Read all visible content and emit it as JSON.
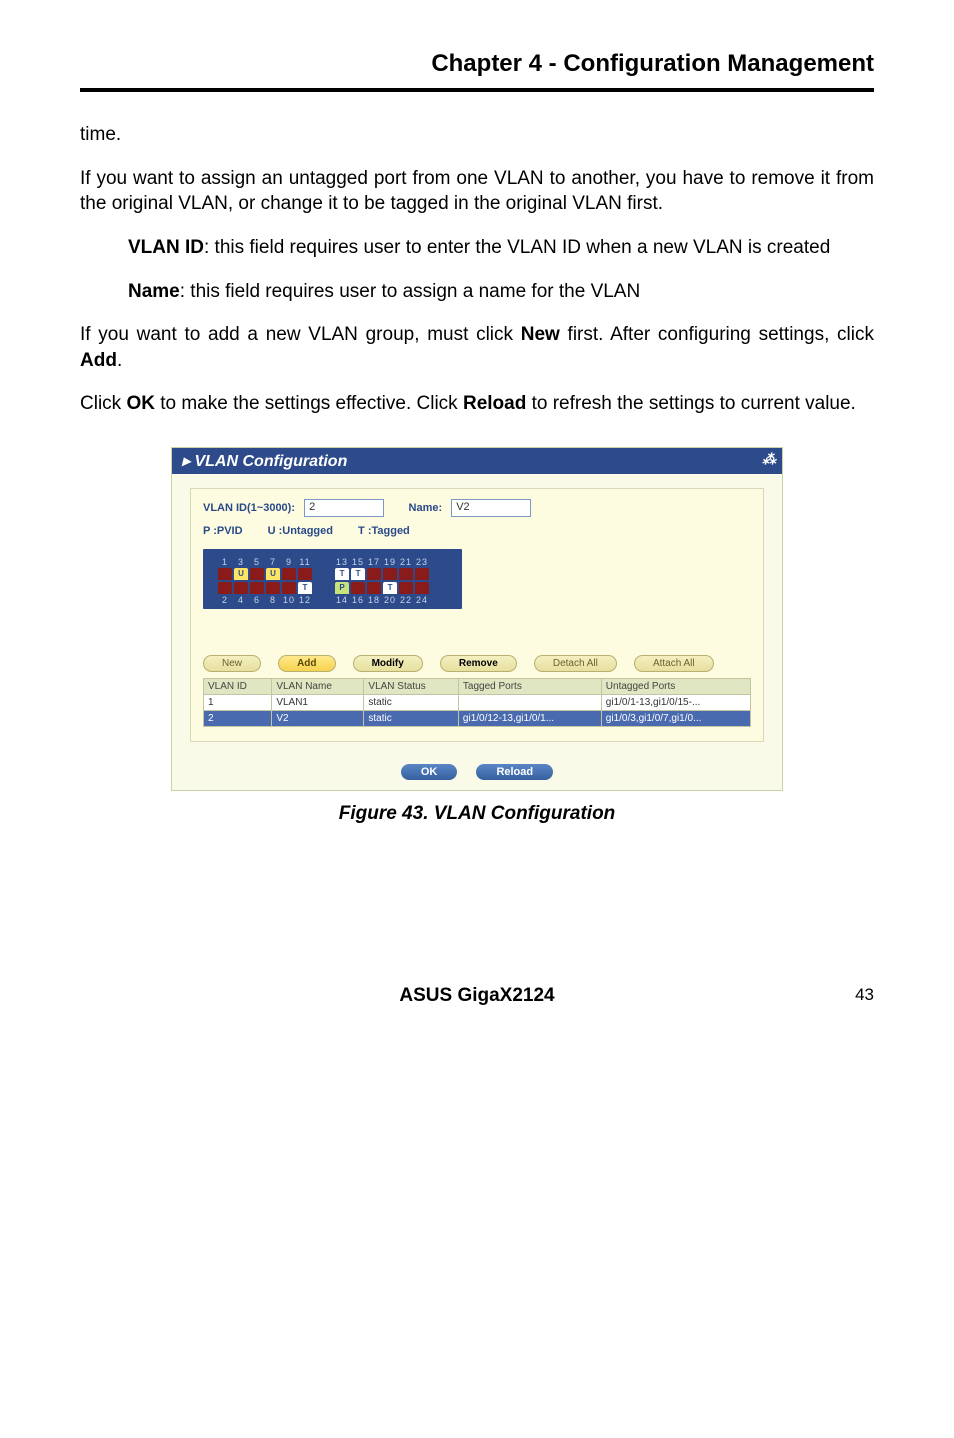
{
  "header": {
    "chapter_title": "Chapter 4 - Configuration Management"
  },
  "body": {
    "p1": "time.",
    "p2": "If you want to assign an untagged port from one VLAN to another, you have to remove it from the original VLAN, or change it to be tagged in the original VLAN first.",
    "vlanid_label": "VLAN ID",
    "vlanid_desc": ": this field requires user to enter the VLAN ID when a new VLAN is created",
    "name_label": "Name",
    "name_desc": ": this field requires user to assign a name for the VLAN",
    "p3a": "If you want to add a new VLAN group, must click ",
    "p3_new": "New",
    "p3b": " first. After configuring settings, click ",
    "p3_add": "Add",
    "p3c": ".",
    "p4a": "Click ",
    "p4_ok": "OK",
    "p4b": " to make the settings effective. Click ",
    "p4_reload": "Reload",
    "p4c": " to refresh the settings to current value."
  },
  "screenshot": {
    "window_title": "VLAN Configuration",
    "vlanid_lbl": "VLAN ID(1~3000):",
    "vlanid_val": "2",
    "name_lbl": "Name:",
    "name_val": "V2",
    "legend_p": "P :PVID",
    "legend_u": "U :Untagged",
    "legend_t": "T :Tagged",
    "top_nums_a": [
      "1",
      "3",
      "5",
      "7",
      "9",
      "11"
    ],
    "bot_nums_a": [
      "2",
      "4",
      "6",
      "8",
      "10",
      "12"
    ],
    "top_nums_b": [
      "13",
      "15",
      "17",
      "19",
      "21",
      "23"
    ],
    "bot_nums_b": [
      "14",
      "16",
      "18",
      "20",
      "22",
      "24"
    ],
    "buttons": {
      "new": "New",
      "add": "Add",
      "modify": "Modify",
      "remove": "Remove",
      "detach_all": "Detach All",
      "attach_all": "Attach All"
    },
    "table": {
      "headers": [
        "VLAN ID",
        "VLAN Name",
        "VLAN Status",
        "Tagged Ports",
        "Untagged Ports"
      ],
      "rows": [
        {
          "id": "1",
          "name": "VLAN1",
          "status": "static",
          "tagged": "",
          "untagged": "gi1/0/1-13,gi1/0/15-..."
        },
        {
          "id": "2",
          "name": "V2",
          "status": "static",
          "tagged": "gi1/0/12-13,gi1/0/1...",
          "untagged": "gi1/0/3,gi1/0/7,gi1/0..."
        }
      ]
    },
    "ok_btn": "OK",
    "reload_btn": "Reload"
  },
  "figure_caption": "Figure 43. VLAN Configuration",
  "footer": {
    "product": "ASUS GigaX2124",
    "page": "43"
  }
}
